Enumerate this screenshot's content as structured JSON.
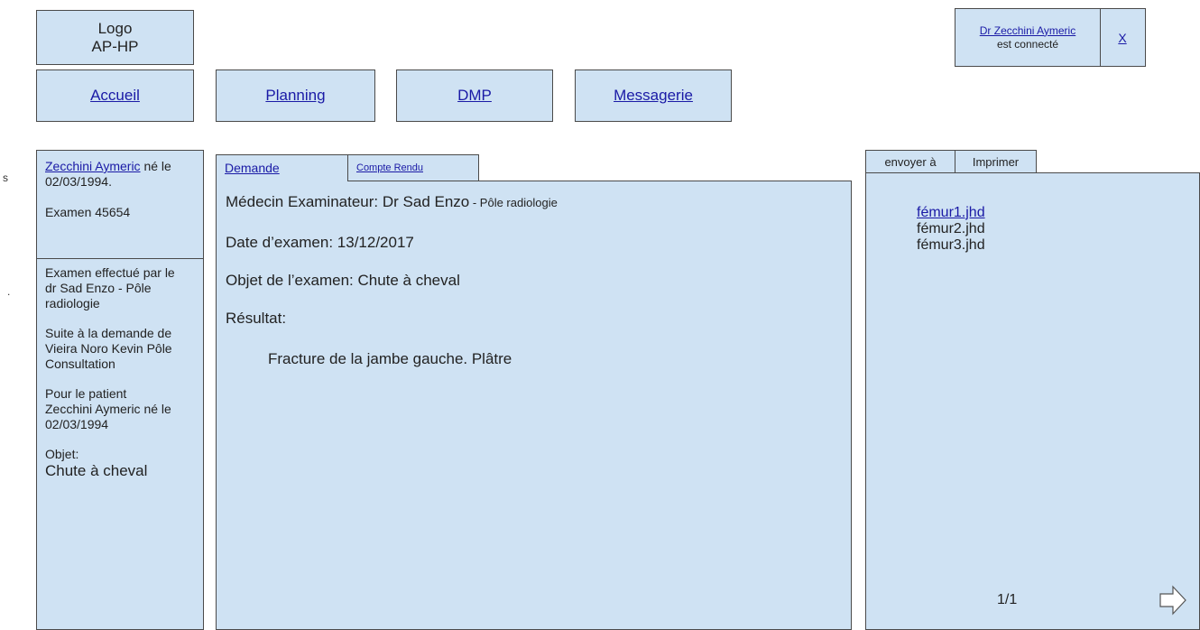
{
  "header": {
    "logo_line1": "Logo",
    "logo_line2": "AP-HP",
    "user_name": "Dr Zecchini Aymeric",
    "user_status": "est connecté",
    "logout_label": "X"
  },
  "nav": {
    "accueil": "Accueil",
    "planning": "Planning",
    "dmp": "DMP",
    "messagerie": "Messagerie"
  },
  "edge_marks": {
    "mark1": "s",
    "mark2": "."
  },
  "patient": {
    "name_link": "Zecchini Aymeric",
    "born_suffix": " né le",
    "birthdate": "02/03/1994.",
    "exam": "Examen 45654"
  },
  "exam_info": {
    "performed_line1": "Examen effectué par le",
    "performed_line2": "dr Sad Enzo  - Pôle",
    "performed_line3": "radiologie",
    "request_line1": "Suite à la demande de",
    "request_line2": "Vieira Noro Kevin Pôle",
    "request_line3": "Consultation",
    "patient_line1": "Pour le patient",
    "patient_line2": "Zecchini Aymeric né le",
    "patient_line3": "02/03/1994",
    "object_label": "Objet:",
    "object_value": "Chute à cheval"
  },
  "tabs": {
    "demande": "Demande",
    "compte_rendu": "Compte Rendu"
  },
  "report": {
    "doctor_label": "Médecin Examinateur: Dr Sad Enzo",
    "doctor_service": " - Pôle radiologie",
    "date_line": "Date d’examen: 13/12/2017",
    "object_line": "Objet de l’examen: Chute à cheval",
    "result_label": "Résultat:",
    "result_text": "Fracture de la jambe gauche. Plâtre"
  },
  "files_panel": {
    "send_button": "envoyer à",
    "print_button": "Imprimer",
    "files": [
      "fémur1.jhd",
      "fémur2.jhd",
      "fémur3.jhd"
    ],
    "page_indicator": "1/1",
    "next_icon": "right-arrow-icon"
  }
}
